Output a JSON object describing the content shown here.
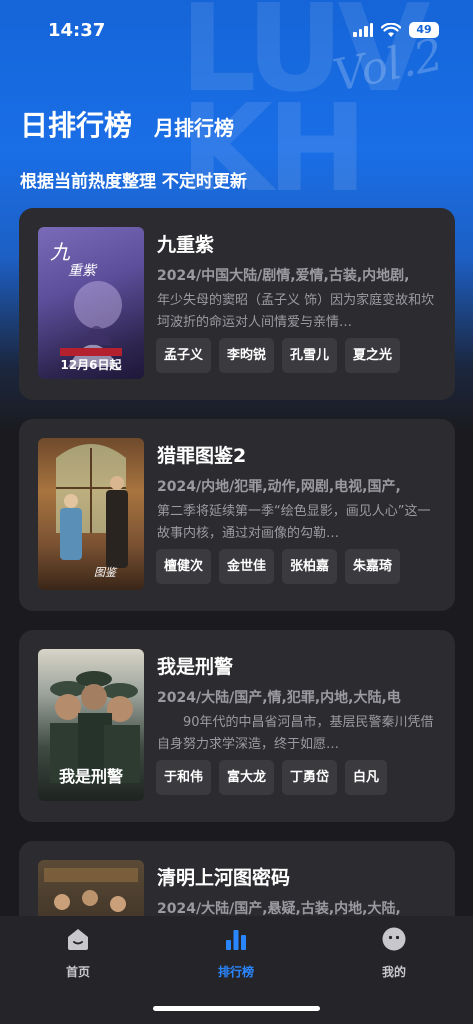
{
  "status": {
    "time": "14:37",
    "battery": "49"
  },
  "tabs": {
    "daily": "日排行榜",
    "monthly": "月排行榜"
  },
  "subtitle": "根据当前热度整理 不定时更新",
  "items": [
    {
      "title": "九重紫",
      "meta": "2024/中国大陆/剧情,爱情,古装,内地剧,",
      "desc": "年少失母的窦昭（孟子义 饰）因为家庭变故和坎坷波折的命运对人间情爱与亲情…",
      "actors": [
        "孟子义",
        "李昀锐",
        "孔雪儿",
        "夏之光"
      ],
      "poster_caption": "12月6日起"
    },
    {
      "title": "猎罪图鉴2",
      "meta": "2024/内地/犯罪,动作,网剧,电视,国产,",
      "desc": "第二季将延续第一季“绘色显影，画见人心”这一故事内核，通过对画像的勾勒…",
      "actors": [
        "檀健次",
        "金世佳",
        "张柏嘉",
        "朱嘉琦"
      ],
      "poster_caption": ""
    },
    {
      "title": "我是刑警",
      "meta": "2024/大陆/国产,情,犯罪,内地,大陆,电",
      "desc": "　　90年代的中昌省河昌市，基层民警秦川凭借自身努力求学深造，终于如愿…",
      "actors": [
        "于和伟",
        "富大龙",
        "丁勇岱",
        "白凡"
      ],
      "poster_caption": "我是刑警"
    },
    {
      "title": "清明上河图密码",
      "meta": "2024/大陆/国产,悬疑,古装,内地,大陆,",
      "desc": "",
      "actors": [],
      "poster_caption": ""
    }
  ],
  "nav": {
    "home": "首页",
    "ranking": "排行榜",
    "mine": "我的"
  },
  "colors": {
    "accent": "#2a86ff",
    "card": "#2c2c30",
    "hero": "#1565d8"
  }
}
